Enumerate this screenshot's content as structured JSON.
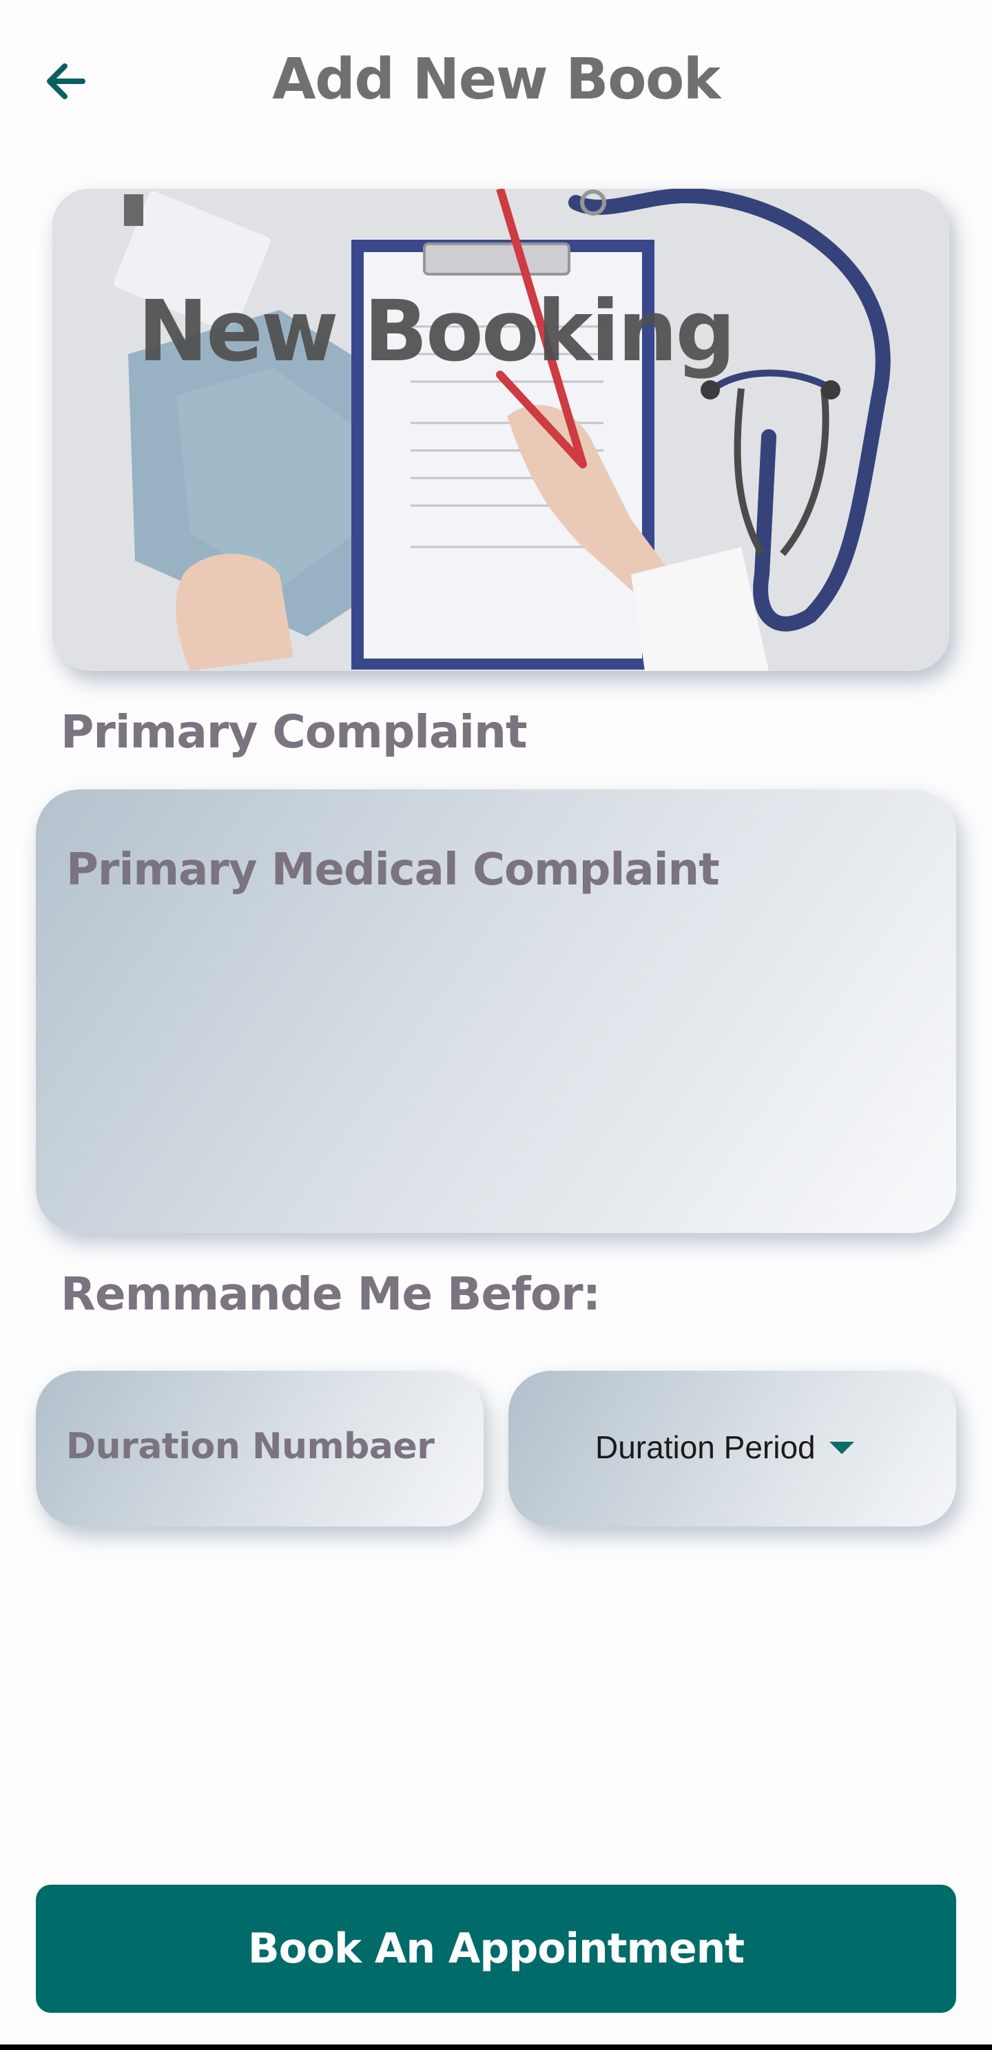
{
  "header": {
    "title": "Add New Book",
    "back_icon": "arrow-left-icon"
  },
  "hero": {
    "title": "New Booking",
    "image": "doctor-clipboard-xray-stethoscope-photo"
  },
  "complaint": {
    "label": "Primary Complaint",
    "placeholder": "Primary Medical Complaint"
  },
  "reminder": {
    "label": "Remmande Me Befor:",
    "duration_number_placeholder": "Duration Numbaer",
    "duration_period_value": "Duration Period",
    "dropdown_icon": "caret-down-icon"
  },
  "actions": {
    "book_label": "Book An Appointment"
  },
  "colors": {
    "primary": "#006b68",
    "label": "#7b7380",
    "title": "#707070"
  }
}
